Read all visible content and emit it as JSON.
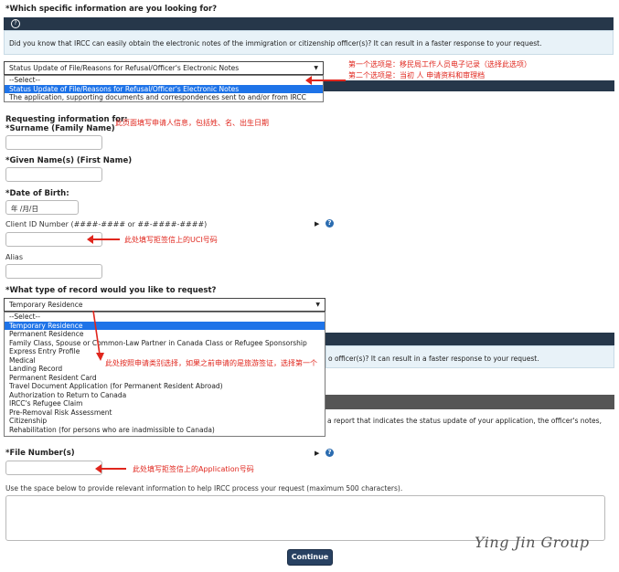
{
  "question1": {
    "heading": "*Which specific information are you looking for?",
    "info_text": "Did you know that IRCC can easily obtain the electronic notes of the immigration or citizenship officer(s)? It can result in a faster response to your request.",
    "select_value": "Status Update of File/Reasons for Refusal/Officer's Electronic Notes",
    "options": [
      "--Select--",
      "Status Update of File/Reasons for Refusal/Officer's Electronic Notes",
      "The application, supporting documents and correspondences sent to and/or from IRCC"
    ],
    "selected_index": 1
  },
  "annotations": {
    "option1": "第一个选项是：移民局工作人员电子记录（选择此选项）",
    "option2": "第二个选项是：当初 人 申请资料和审理档",
    "applicant": "此页面填写申请人信息，包括姓、名、出生日期",
    "uci": "此处填写拒签信上的UCI号码",
    "record_type": "此处按照申请类别选择，如果之前申请的是旅游签证，选择第一个",
    "file_number": "此处填写拒签信上的Application号码"
  },
  "applicant": {
    "requesting_label": "Requesting information for:",
    "surname_label": "*Surname (Family Name)",
    "given_label": "*Given Name(s) (First Name)",
    "dob_label": "*Date of Birth:",
    "dob_placeholder": "年 /月/日",
    "client_id_label": "Client ID Number (####-#### or ##-####-####)",
    "alias_label": "Alias"
  },
  "question2": {
    "heading": "*What type of record would you like to request?",
    "select_value": "Temporary Residence",
    "options": [
      "--Select--",
      "Temporary Residence",
      "Permanent Residence",
      "Family Class, Spouse or Common-Law Partner in Canada Class or Refugee Sponsorship",
      "Express Entry Profile",
      "Medical",
      "Landing Record",
      "Permanent Resident Card",
      "Travel Document Application (for Permanent Resident Abroad)",
      "Authorization to Return to Canada",
      "IRCC's Refugee Claim",
      "Pre-Removal Risk Assessment",
      "Citizenship",
      "Rehabilitation (for persons who are inadmissible to Canada)"
    ],
    "selected_index": 1,
    "behind_text_1": "o officer(s)? It can result in a faster response to your request.",
    "behind_text_2": "a report that indicates the status update of your application, the officer's notes,"
  },
  "file_number": {
    "label": "*File Number(s)"
  },
  "request_box": {
    "instructions": "Use the space below to provide relevant information to help IRCC process your request (maximum 500 characters)."
  },
  "continue_label": "Continue",
  "brand": "Ying Jin Group",
  "colors": {
    "header_bar": "#26374a",
    "info_bg": "#e8f2f8",
    "highlight": "#1e73e8",
    "annotation": "#e0261d",
    "button": "#284162"
  }
}
